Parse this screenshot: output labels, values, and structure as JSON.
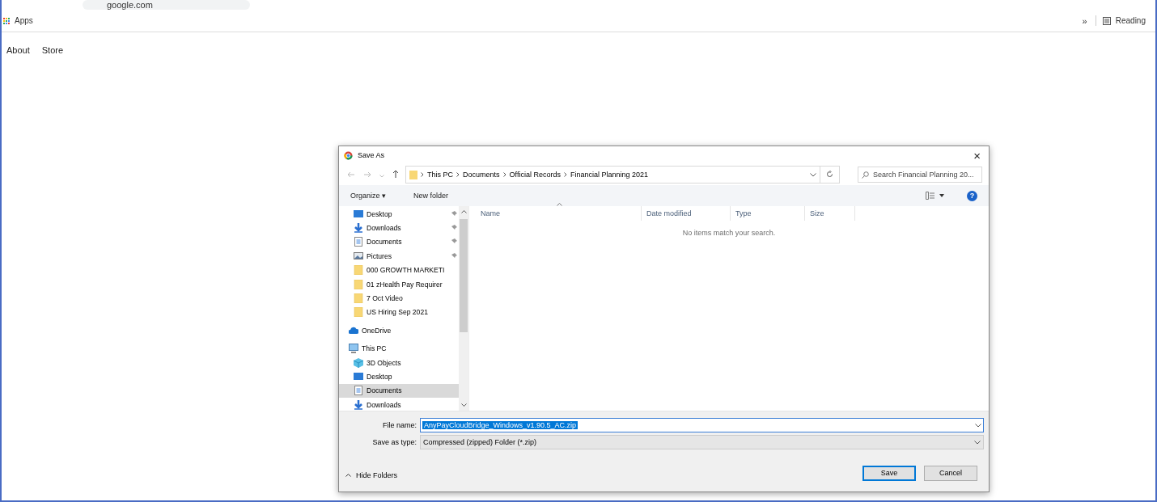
{
  "browser": {
    "address": "google.com",
    "bookmarks": [
      {
        "label": "Apps"
      }
    ],
    "overflow": "»",
    "reading_list": "Reading"
  },
  "page": {
    "links": [
      "About",
      "Store"
    ]
  },
  "dialog": {
    "title": "Save As",
    "close": "×",
    "breadcrumb": [
      "This PC",
      "Documents",
      "Official Records",
      "Financial Planning 2021"
    ],
    "search": {
      "placeholder": "Search Financial Planning 20..."
    },
    "toolbar": {
      "organize": "Organize ▾",
      "new_folder": "New folder",
      "help": "?"
    },
    "nav": [
      {
        "children": [
          {
            "label": "Desktop",
            "kind": "desktop",
            "pinned": true,
            "selected": false
          },
          {
            "label": "Downloads",
            "kind": "download",
            "pinned": true,
            "selected": false
          },
          {
            "label": "Documents",
            "kind": "document",
            "pinned": true,
            "selected": false
          },
          {
            "label": "Pictures",
            "kind": "picture",
            "pinned": true,
            "selected": false
          },
          {
            "label": "000 GROWTH MARKETI",
            "kind": "folder",
            "pinned": false,
            "selected": false
          },
          {
            "label": "01 zHealth Pay Requirer",
            "kind": "folder",
            "pinned": false,
            "selected": false
          },
          {
            "label": "7 Oct Video",
            "kind": "folder",
            "pinned": false,
            "selected": false
          },
          {
            "label": "US Hiring Sep 2021",
            "kind": "folder",
            "pinned": false,
            "selected": false
          }
        ]
      },
      {
        "label": "OneDrive",
        "kind": "cloud",
        "pinned": false,
        "selected": false
      },
      {
        "label": "This PC",
        "kind": "pc",
        "pinned": false,
        "selected": false,
        "children": [
          {
            "label": "3D Objects",
            "kind": "cube",
            "pinned": false,
            "selected": false
          },
          {
            "label": "Desktop",
            "kind": "desktop",
            "pinned": false,
            "selected": false
          },
          {
            "label": "Documents",
            "kind": "document",
            "pinned": false,
            "selected": true
          },
          {
            "label": "Downloads",
            "kind": "download",
            "pinned": false,
            "selected": false
          }
        ]
      }
    ],
    "columns": [
      {
        "label": "Name",
        "sorted": true
      },
      {
        "label": "Date modified",
        "sorted": false
      },
      {
        "label": "Type",
        "sorted": false
      },
      {
        "label": "Size",
        "sorted": false
      }
    ],
    "empty_message": "No items match your search.",
    "file_name": {
      "label": "File name:",
      "value": "AnyPayCloudBridge_Windows_v1.90.5_AC.zip"
    },
    "save_type": {
      "label": "Save as type:",
      "value": "Compressed (zipped) Folder (*.zip)"
    },
    "hide_folders": "Hide Folders",
    "buttons": [
      {
        "label": "Save",
        "default": true
      },
      {
        "label": "Cancel",
        "default": false
      }
    ]
  }
}
